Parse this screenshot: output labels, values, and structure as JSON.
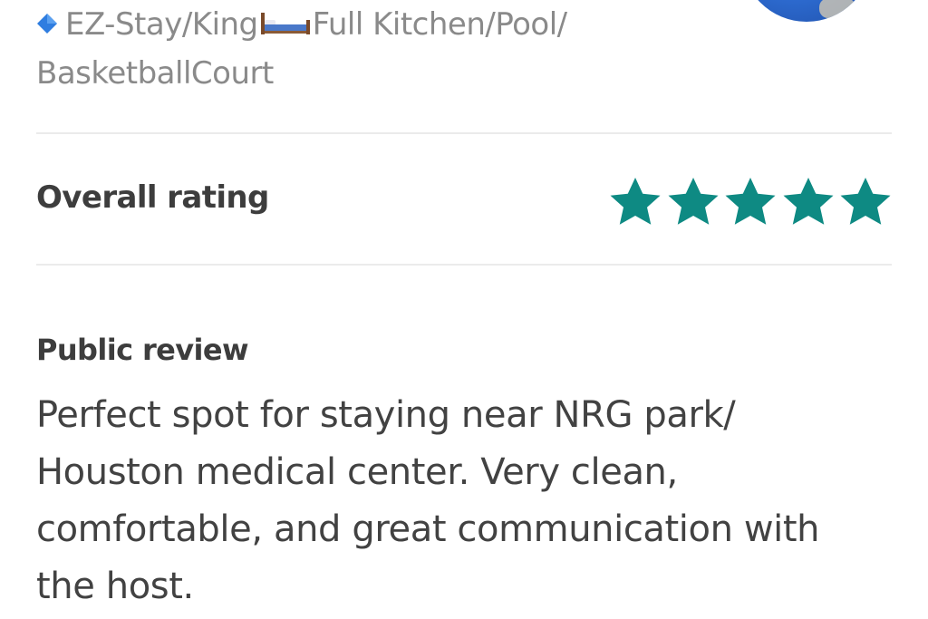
{
  "listing": {
    "title_line1_a": "EZ-Stay/King",
    "title_line1_b": "Full Kitchen/Pool/",
    "title_line2": "BasketballCourt",
    "icons": [
      "blue-diamond-icon",
      "bed-icon"
    ]
  },
  "host": {
    "avatar": "host-avatar"
  },
  "rating": {
    "label": "Overall rating",
    "stars": 5,
    "max_stars": 5,
    "star_color": "#0e8a83"
  },
  "review": {
    "heading": "Public review",
    "lines": [
      "Perfect spot for staying near NRG park/",
      "Houston medical center. Very clean,",
      "comfortable, and great communication with",
      "the host."
    ]
  }
}
